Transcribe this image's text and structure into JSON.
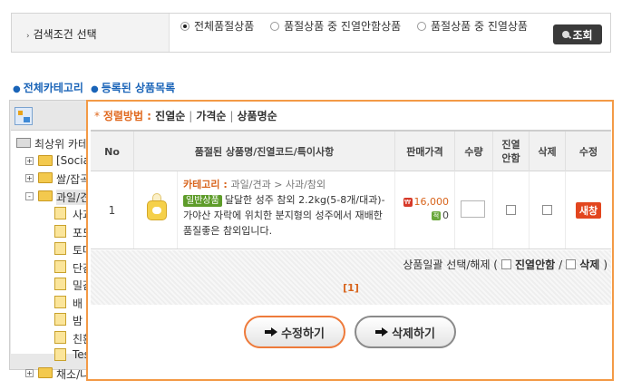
{
  "search": {
    "title": "검색조건 선택",
    "options": [
      "전체품절상품",
      "품절상품 중 진열안함상품",
      "품절상품 중 진열상품"
    ],
    "selected_option": "전체품절상품",
    "query_button": "조회"
  },
  "links": {
    "all_category": "전체카테고리",
    "registered_products": "등록된 상품목록"
  },
  "tree": {
    "items": [
      {
        "label": "최상위 카테고리",
        "type": "root"
      },
      {
        "label": "[Social]",
        "type": "folder",
        "toggle": "+"
      },
      {
        "label": "쌀/잡곡",
        "type": "folder",
        "toggle": "+"
      },
      {
        "label": "과일/견과",
        "type": "folder",
        "toggle": "-",
        "selected": true
      },
      {
        "label": "사과/참외",
        "type": "doc"
      },
      {
        "label": "포도",
        "type": "doc"
      },
      {
        "label": "토마토",
        "type": "doc"
      },
      {
        "label": "단감",
        "type": "doc"
      },
      {
        "label": "밀감",
        "type": "doc"
      },
      {
        "label": "배",
        "type": "doc"
      },
      {
        "label": "밤",
        "type": "doc"
      },
      {
        "label": "친환경",
        "type": "doc"
      },
      {
        "label": "Test",
        "type": "doc"
      },
      {
        "label": "채소/나물",
        "type": "folder",
        "toggle": "+"
      }
    ]
  },
  "sort": {
    "title": "정렬방법",
    "options": [
      "진열순",
      "가격순",
      "상품명순"
    ]
  },
  "table": {
    "headers": {
      "no": "No",
      "name": "품절된 상품명/진열코드/특이사항",
      "price": "판매가격",
      "qty": "수량",
      "display_off_1": "진열",
      "display_off_2": "안함",
      "delete": "삭제",
      "edit": "수정"
    },
    "rows": [
      {
        "no": "1",
        "category_title": "카테고리",
        "category_path": "과일/견과 > 사과/참외",
        "badge": "일반상품",
        "name": "달달한 성주 참외 2.2kg(5-8개/대과)-가야산 자락에 위치한 분지형의 성주에서 재배한 품질좋은 참외입니다.",
        "price": "16,000",
        "points": "0",
        "qty": "",
        "edit_label": "새창"
      }
    ]
  },
  "bulk": {
    "label": "상품일괄 선택/해제 (",
    "option1": "진열안함",
    "divider": "/",
    "option2": "삭제",
    "close": ")"
  },
  "pager": "[1]",
  "buttons": {
    "edit": "수정하기",
    "delete": "삭제하기"
  },
  "colors": {
    "accent_orange": "#f39a46",
    "link_blue": "#1a64b8",
    "badge_green": "#5e9c2a",
    "new_window_red": "#e2461f"
  }
}
